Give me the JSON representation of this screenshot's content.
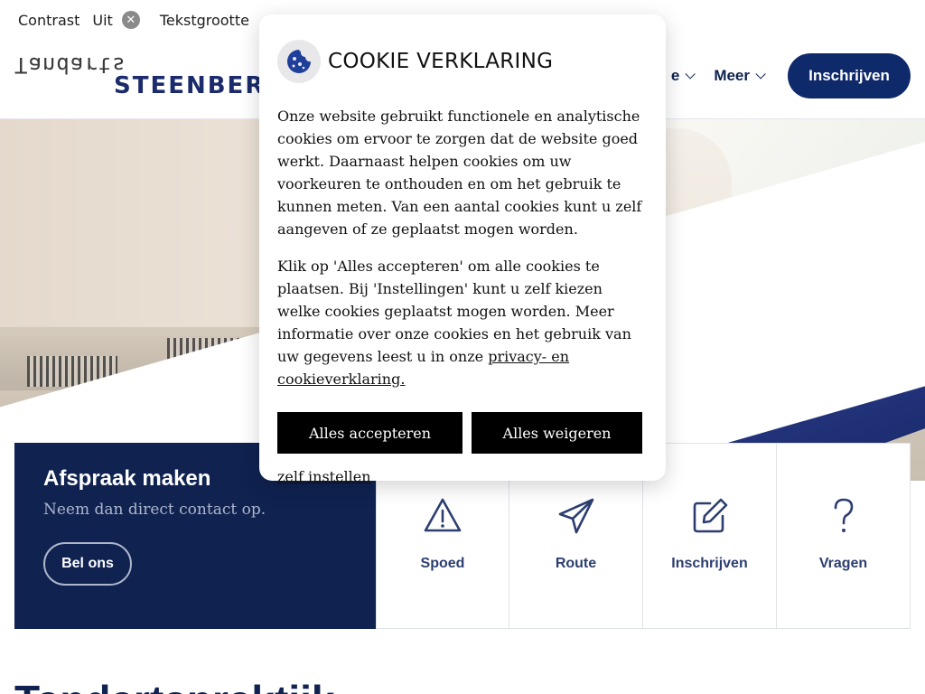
{
  "topbar": {
    "contrast_label": "Contrast",
    "contrast_value": "Uit",
    "textsize_label": "Tekstgrootte"
  },
  "header": {
    "logo_top": "Tandarts",
    "logo_bottom": "STEENBERGEN",
    "nav": [
      {
        "label": "e"
      },
      {
        "label": "Meer"
      }
    ],
    "register_button": "Inschrijven"
  },
  "appointment": {
    "title": "Afspraak maken",
    "subtitle": "Neem dan direct contact op.",
    "call_button": "Bel ons"
  },
  "tiles": [
    {
      "label": "Spoed",
      "icon": "warning-triangle-icon"
    },
    {
      "label": "Route",
      "icon": "paper-plane-icon"
    },
    {
      "label": "Inschrijven",
      "icon": "edit-icon"
    },
    {
      "label": "Vragen",
      "icon": "question-mark-icon"
    }
  ],
  "bottom_heading": "Tandartspraktijk",
  "cookie_modal": {
    "title": "COOKIE VERKLARING",
    "paragraph1": "Onze website gebruikt functionele en analytische cookies om ervoor te zorgen dat de website goed werkt. Daarnaast helpen cookies om uw voorkeuren te onthouden en om het gebruik te kunnen meten. Van een aantal cookies kunt u zelf aangeven of ze geplaatst mogen worden.",
    "paragraph2": "Klik op 'Alles accepteren' om alle cookies te plaatsen. Bij 'Instellingen' kunt u zelf kiezen welke cookies geplaatst mogen worden. Meer informatie over onze cookies en het gebruik van uw gegevens leest u in onze ",
    "privacy_link": "privacy- en cookieverklaring.",
    "accept_button": "Alles accepteren",
    "refuse_button": "Alles weigeren",
    "settings_link": "zelf instellen"
  },
  "colors": {
    "navy": "#0f2250",
    "brand_blue": "#0f2a6b",
    "button_black": "#000000",
    "cookie_icon_blue": "#1f3f9b"
  }
}
